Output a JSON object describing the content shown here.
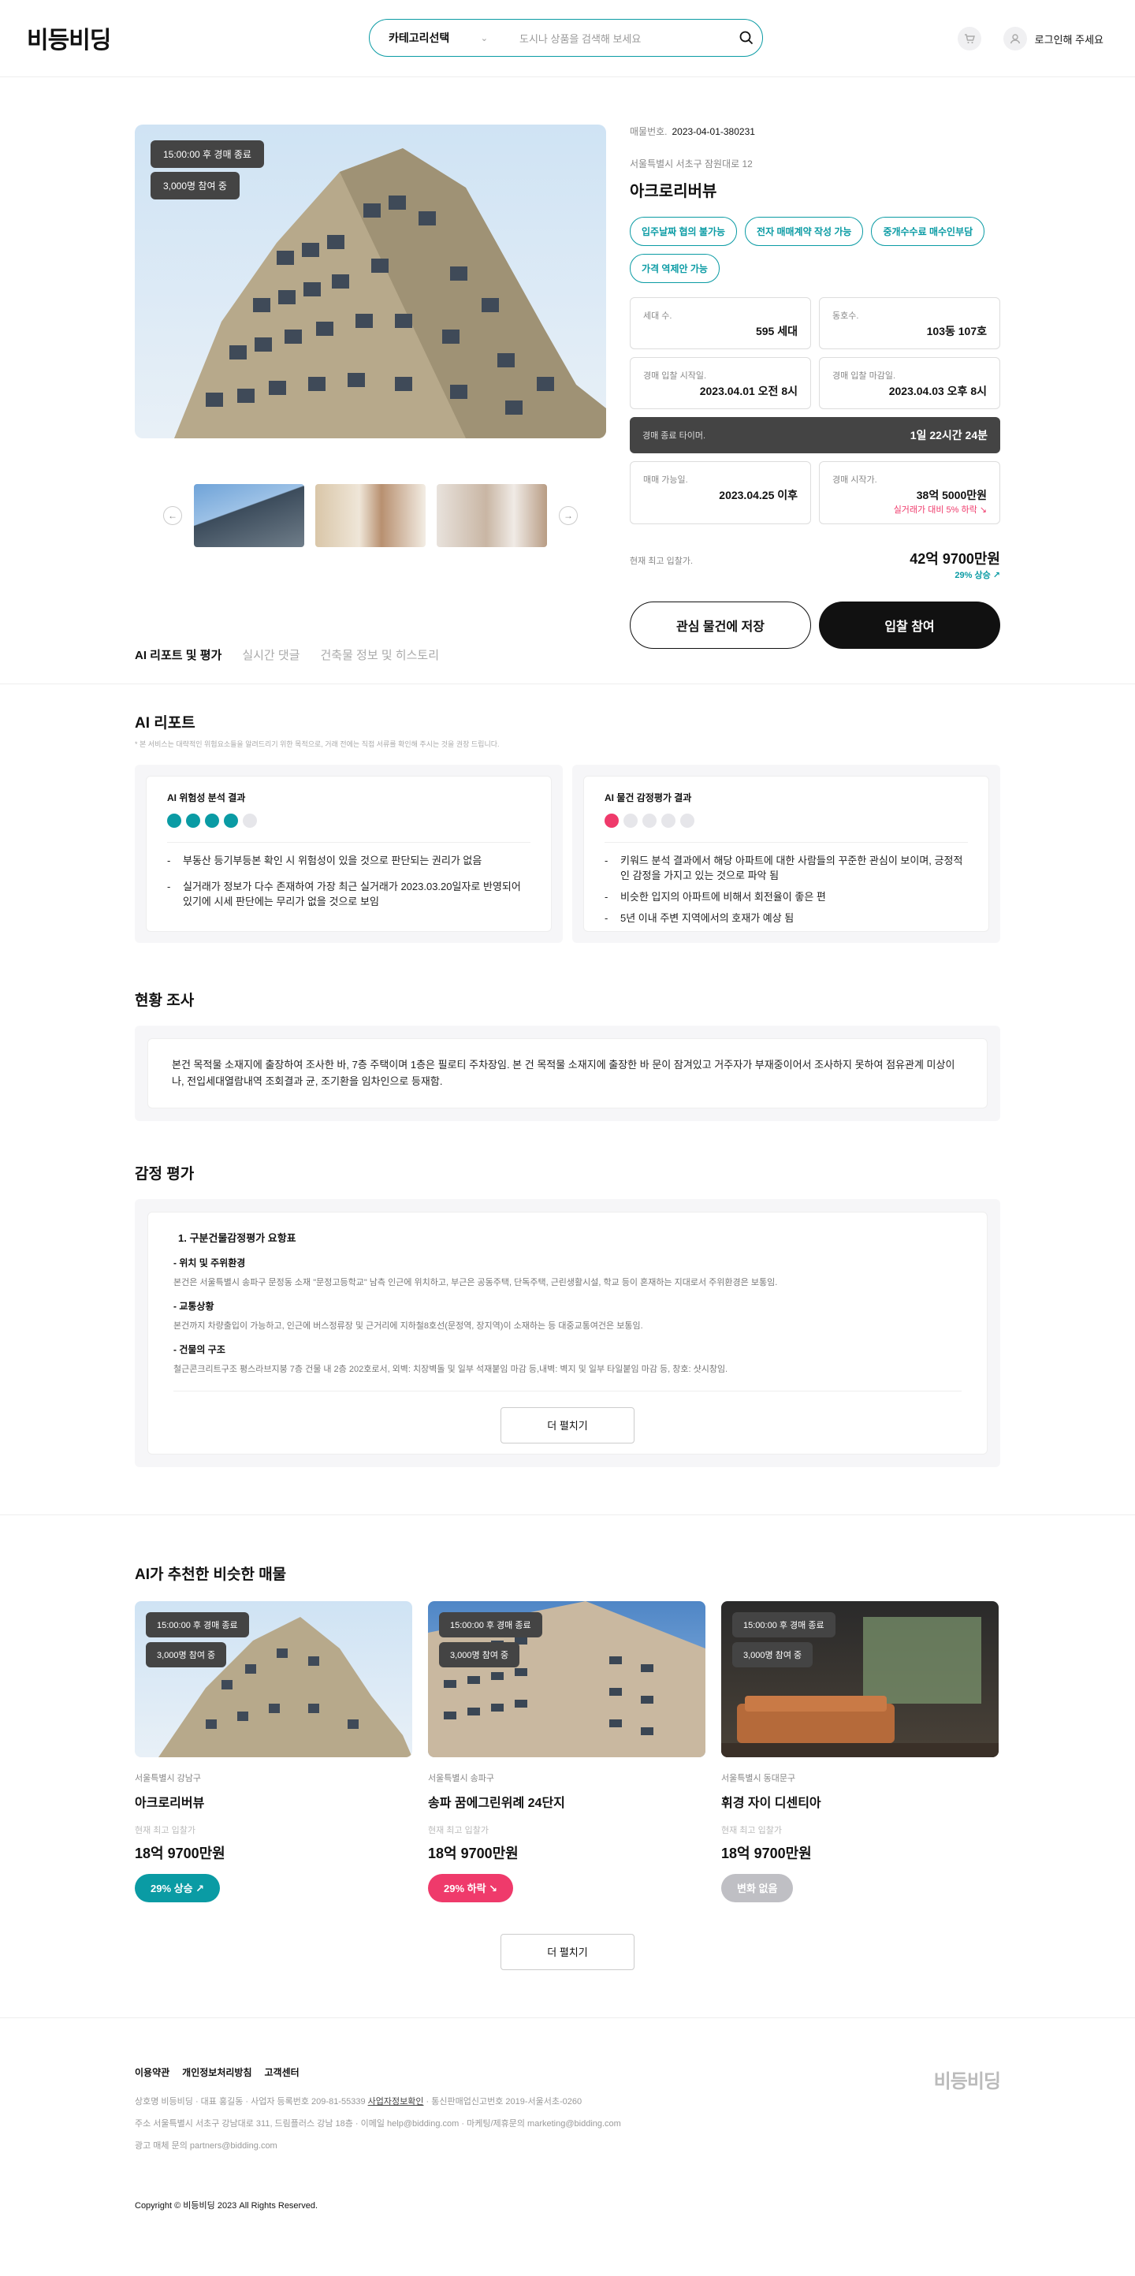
{
  "header": {
    "logo": "비등비딩",
    "category_label": "카테고리선택",
    "search_placeholder": "도시나 상품을 검색해 보세요",
    "login_label": "로그인해 주세요"
  },
  "hero": {
    "badge_time": "15:00:00 후 경매 종료",
    "badge_count": "3,000명 참여 중"
  },
  "listing": {
    "reg_label": "매물번호.",
    "reg_no": "2023-04-01-380231",
    "address": "서울특별시 서초구 잠원대로 12",
    "title": "아크로리버뷰",
    "tags": [
      "입주날짜 협의 불가능",
      "전자 매매계약 작성 가능",
      "중개수수료 매수인부담",
      "가격 역제안 가능"
    ],
    "cells": [
      {
        "label": "세대 수.",
        "value": "595 세대"
      },
      {
        "label": "동호수.",
        "value": "103동 107호"
      },
      {
        "label": "경매 입찰 시작일.",
        "value": "2023.04.01 오전 8시"
      },
      {
        "label": "경매 입찰 마감일.",
        "value": "2023.04.03 오후 8시"
      }
    ],
    "timer_label": "경매 종료 타이머.",
    "timer_value": "1일 22시간 24분",
    "cells2": [
      {
        "label": "매매 가능일.",
        "value": "2023.04.25 이후",
        "sub": ""
      },
      {
        "label": "경매 시작가.",
        "value": "38억 5000만원",
        "sub": "실거래가 대비 5% 하락 ↘"
      }
    ],
    "high_bid_label": "현재 최고 입찰가.",
    "high_bid_value": "42억 9700만원",
    "high_bid_rate": "29% 상승 ↗",
    "save_btn": "관심 물건에 저장",
    "bid_btn": "입찰 참여"
  },
  "tabs": [
    "AI 리포트 및 평가",
    "실시간 댓글",
    "건축물 정보 및 히스토리"
  ],
  "ai_report": {
    "title": "AI 리포트",
    "note": "* 본 서비스는 대략적인 위험요소들을 알려드리기 위한 목적으로, 거래 전에는 직접 서류를 확인해 주시는 것을 권장 드립니다.",
    "risk": {
      "title": "AI 위험성 분석 결과",
      "level": 4,
      "items": [
        "부동산 등기부등본 확인 시 위험성이 있을 것으로 판단되는 권리가 없음",
        "실거래가 정보가 다수 존재하여 가장 최근 실거래가 2023.03.20일자로 반영되어 있기에 시세 판단에는 무리가 없을 것으로 보임"
      ]
    },
    "sentiment": {
      "title": "AI 물건 감정평가 결과",
      "level": 1,
      "items": [
        "키워드 분석 결과에서 해당 아파트에 대한 사람들의 꾸준한 관심이 보이며, 긍정적인 감정을 가지고 있는 것으로 파악 됨",
        "비슷한 입지의 아파트에 비해서 회전율이 좋은 편",
        "5년 이내 주변 지역에서의 호재가 예상 됨"
      ]
    }
  },
  "survey": {
    "title": "현황 조사",
    "text": "본건 목적물 소재지에 출장하여 조사한 바, 7층 주택이며 1층은 필로티 주차장임. 본 건 목적물 소재지에 출장한 바 문이 잠겨있고 거주자가 부재중이어서 조사하지 못하여 점유관계 미상이나, 전입세대열람내역 조회결과 균, 조기환을 임차인으로 등재함."
  },
  "appraisal": {
    "title": "감정 평가",
    "heading": "1. 구분건물감정평가 요항표",
    "items": [
      {
        "sub": "- 위치 및 주위환경",
        "text": "본건은 서울특별시 송파구 문정동 소재 \"문정고등학교\" 남측 인근에 위치하고, 부근은 공동주택, 단독주택, 근린생활시설, 학교 등이 혼재하는 지대로서 주위환경은 보통임."
      },
      {
        "sub": "- 교통상황",
        "text": "본건까지 차량출입이 가능하고, 인근에 버스정류장 및 근거리에 지하철8호선(문정역, 장지역)이 소재하는 등 대중교통여건은 보통임."
      },
      {
        "sub": "- 건물의 구조",
        "text": "철근콘크리트구조 평스라브지붕 7층 건물 내 2층 202호로서, 외벽: 치장벽돌 및 일부 석재붙임 마감 등,내벽: 벽지 및 일부 타일붙임 마감 등, 창호: 샷시창임."
      }
    ],
    "more": "더 펼치기"
  },
  "recommend": {
    "title": "AI가 추천한 비슷한 매물",
    "cards": [
      {
        "loc": "서울특별시 강남구",
        "name": "아크로리버뷰",
        "label": "현재 최고 입찰가",
        "price": "18억 9700만원",
        "pill": "29% 상승 ↗",
        "color": "#0a9ba4"
      },
      {
        "loc": "서울특별시 송파구",
        "name": "송파 꿈에그린위례 24단지",
        "label": "현재 최고 입찰가",
        "price": "18억 9700만원",
        "pill": "29% 하락 ↘",
        "color": "#ef3a6b"
      },
      {
        "loc": "서울특별시 동대문구",
        "name": "휘경 자이 디센티아",
        "label": "현재 최고 입찰가",
        "price": "18억 9700만원",
        "pill": "변화 없음",
        "color": "#bfbfc4"
      }
    ],
    "more": "더 펼치기"
  },
  "footer": {
    "links": [
      "이용약관",
      "개인정보처리방침",
      "고객센터"
    ],
    "line1a": "상호명 비등비딩   ·   대표 홍길동   ·   사업자 등록번호 209-81-55339 ",
    "line1b": "사업자정보확인",
    "line1c": "   ·   통신판매업신고번호 2019-서울서초-0260",
    "line2": "주소 서울특별시 서초구 강남대로 311, 드림플러스 강남 18층   ·   이메일 help@bidding.com   ·   마케팅/제휴문의 marketing@bidding.com",
    "line3": "광고 매체 문의 partners@bidding.com",
    "copyright": "Copyright © 비등비딩 2023 All Rights Reserved.",
    "logo": "비등비딩"
  }
}
